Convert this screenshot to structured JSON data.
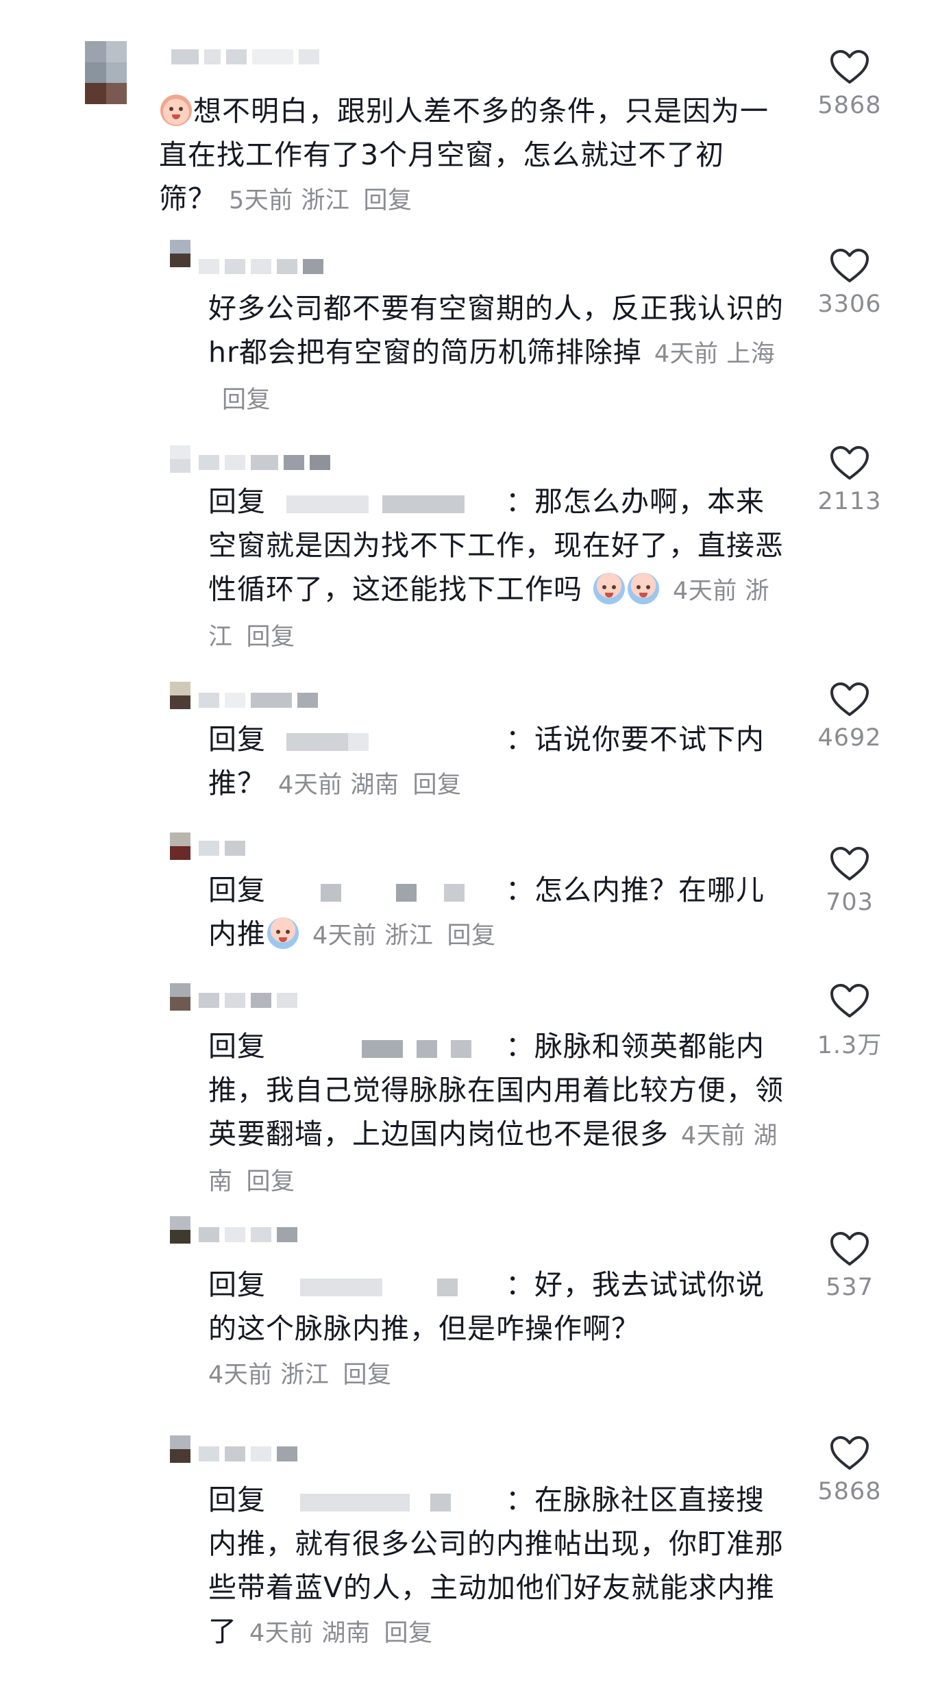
{
  "comments": [
    {
      "text": "想不明白，跟别人差不多的条件，只是因为一直在找工作有了3个月空窗，怎么就过不了初筛？",
      "time": "5天前",
      "location": "浙江",
      "reply": "回复",
      "likes": "5868"
    },
    {
      "text": "好多公司都不要有空窗期的人，反正我认识的hr都会把有空窗的简历机筛排除掉",
      "time": "4天前",
      "location": "上海",
      "reply": "回复",
      "likes": "3306"
    },
    {
      "prefix": "回复",
      "text": "：那怎么办啊，本来空窗就是因为找不下工作，现在好了，直接恶性循环了，这还能找下工作吗",
      "time": "4天前",
      "location": "浙江",
      "reply": "回复",
      "likes": "2113"
    },
    {
      "prefix": "回复",
      "text": "：话说你要不试下内推？",
      "time": "4天前",
      "location": "湖南",
      "reply": "回复",
      "likes": "4692"
    },
    {
      "prefix": "回复",
      "text": "：怎么内推？在哪儿内推",
      "time": "4天前",
      "location": "浙江",
      "reply": "回复",
      "likes": "703"
    },
    {
      "prefix": "回复",
      "text": "：脉脉和领英都能内推，我自己觉得脉脉在国内用着比较方便，领英要翻墙，上边国内岗位也不是很多",
      "time": "4天前",
      "location": "湖南",
      "reply": "回复",
      "likes": "1.3万"
    },
    {
      "prefix": "回复",
      "text": "：好，我去试试你说的这个脉脉内推，但是咋操作啊？",
      "time": "4天前",
      "location": "浙江",
      "reply": "回复",
      "likes": "537"
    },
    {
      "prefix": "回复",
      "text": "：在脉脉社区直接搜内推，就有很多公司的内推帖出现，你盯准那些带着蓝V的人，主动加他们好友就能求内推了",
      "time": "4天前",
      "location": "湖南",
      "reply": "回复",
      "likes": "5868"
    }
  ],
  "icons": {
    "like": "heart-outline-icon"
  }
}
